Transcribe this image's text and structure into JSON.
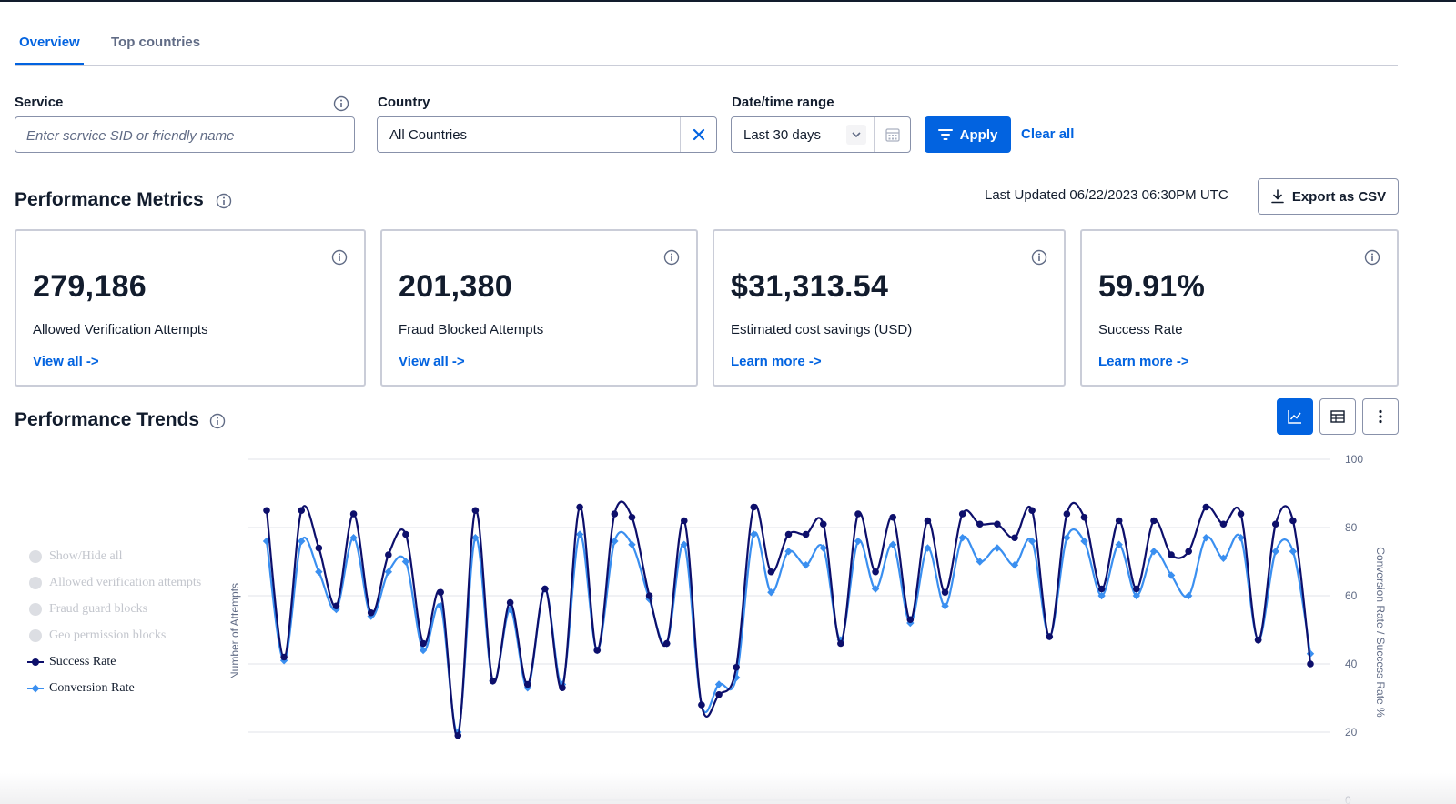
{
  "tabs": [
    {
      "label": "Overview",
      "active": true
    },
    {
      "label": "Top countries",
      "active": false
    }
  ],
  "filters": {
    "service": {
      "label": "Service",
      "placeholder": "Enter service SID or friendly name",
      "value": ""
    },
    "country": {
      "label": "Country",
      "value": "All Countries"
    },
    "date_range": {
      "label": "Date/time range",
      "value": "Last 30 days"
    },
    "apply_label": "Apply",
    "clear_all_label": "Clear all"
  },
  "metrics": {
    "title": "Performance Metrics",
    "last_updated": "Last Updated 06/22/2023 06:30PM UTC",
    "export_label": "Export as CSV",
    "cards": [
      {
        "value": "279,186",
        "label": "Allowed Verification Attempts",
        "link": "View all ->"
      },
      {
        "value": "201,380",
        "label": "Fraud Blocked Attempts",
        "link": "View all ->"
      },
      {
        "value": "$31,313.54",
        "label": "Estimated cost savings (USD)",
        "link": "Learn more ->"
      },
      {
        "value": "59.91%",
        "label": "Success Rate",
        "link": "Learn more ->"
      }
    ]
  },
  "trends": {
    "title": "Performance Trends",
    "view_modes": [
      {
        "icon": "line-chart-icon",
        "active": true
      },
      {
        "icon": "table-icon",
        "active": false
      },
      {
        "icon": "more-vertical-icon",
        "active": false
      }
    ],
    "legend": [
      {
        "label": "Show/Hide all",
        "enabled": false
      },
      {
        "label": "Allowed verification attempts",
        "enabled": false
      },
      {
        "label": "Fraud guard blocks",
        "enabled": false
      },
      {
        "label": "Geo permission blocks",
        "enabled": false
      },
      {
        "label": "Success Rate",
        "enabled": true
      },
      {
        "label": "Conversion Rate",
        "enabled": true
      }
    ]
  },
  "colors": {
    "accent": "#0263e0",
    "success_rate": "#0d0f6b",
    "conversion_rate": "#3a8ff0",
    "legend_disabled": "#c3c6cd",
    "grid": "#e1e3ea"
  },
  "chart_data": {
    "type": "line",
    "xlabel": "",
    "ylabel_left": "Number of Attempts",
    "ylabel_right": "Conversion Rate / Success Rate %",
    "y_right_ticks": [
      "0",
      "20",
      "40",
      "60",
      "80",
      "100"
    ],
    "y_right_lim": [
      0,
      100
    ],
    "grid": true,
    "legend_position": "left",
    "series": [
      {
        "name": "Success Rate",
        "marker": "circle",
        "values": [
          85,
          42,
          85,
          74,
          57,
          84,
          55,
          72,
          78,
          46,
          61,
          19,
          85,
          35,
          58,
          34,
          62,
          33,
          86,
          44,
          84,
          83,
          60,
          46,
          82,
          28,
          31,
          39,
          86,
          67,
          78,
          78,
          81,
          46,
          84,
          67,
          83,
          53,
          82,
          61,
          84,
          81,
          81,
          77,
          85,
          48,
          84,
          83,
          62,
          82,
          62,
          82,
          72,
          73,
          86,
          81,
          84,
          47,
          81,
          82,
          40
        ]
      },
      {
        "name": "Conversion Rate",
        "marker": "diamond",
        "values": [
          76,
          41,
          76,
          67,
          56,
          77,
          54,
          67,
          70,
          44,
          57,
          20,
          77,
          35,
          56,
          33,
          62,
          34,
          78,
          44,
          76,
          75,
          59,
          46,
          75,
          28,
          34,
          36,
          78,
          61,
          73,
          69,
          74,
          47,
          76,
          62,
          75,
          52,
          74,
          57,
          77,
          70,
          74,
          69,
          76,
          48,
          77,
          76,
          60,
          75,
          60,
          73,
          66,
          60,
          77,
          71,
          77,
          47,
          73,
          73,
          43
        ]
      }
    ]
  }
}
